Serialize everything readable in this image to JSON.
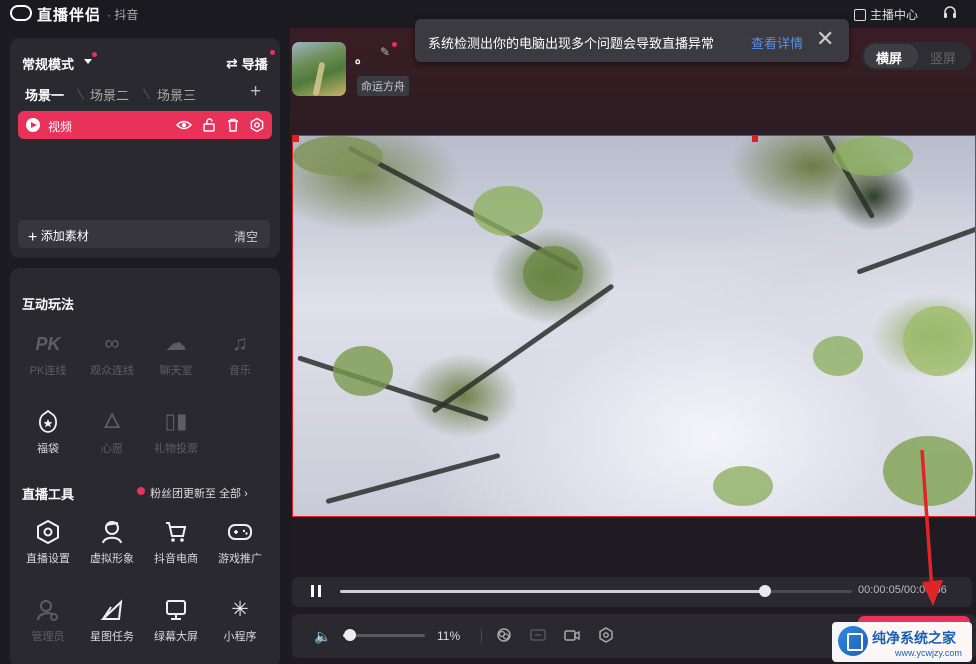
{
  "app": {
    "title": "直播伴侣",
    "platform": "· 抖音",
    "anchor_center": "主播中心"
  },
  "scene_panel": {
    "mode": "常规模式",
    "guide": "导播",
    "tabs": [
      "场景一",
      "场景二",
      "场景三"
    ],
    "source": {
      "name": "视频"
    },
    "add_material": "添加素材",
    "clear": "清空"
  },
  "interact": {
    "title": "互动玩法",
    "items": [
      {
        "label": "PK连线",
        "icon": "pk-icon"
      },
      {
        "label": "观众连线",
        "icon": "link-icon"
      },
      {
        "label": "聊天室",
        "icon": "chat-room-icon"
      },
      {
        "label": "音乐",
        "icon": "music-icon"
      },
      {
        "label": "福袋",
        "icon": "lucky-bag-icon"
      },
      {
        "label": "心愿",
        "icon": "wish-icon"
      },
      {
        "label": "礼物投票",
        "icon": "gift-vote-icon"
      }
    ]
  },
  "live_tools": {
    "title": "直播工具",
    "fans_update": "粉丝团更新至",
    "all": "全部",
    "items": [
      {
        "label": "直播设置",
        "icon": "live-settings-icon"
      },
      {
        "label": "虚拟形象",
        "icon": "avatar-icon"
      },
      {
        "label": "抖音电商",
        "icon": "cart-icon"
      },
      {
        "label": "游戏推广",
        "icon": "gamepad-icon"
      },
      {
        "label": "管理员",
        "icon": "admin-icon"
      },
      {
        "label": "星图任务",
        "icon": "star-task-icon"
      },
      {
        "label": "绿幕大屏",
        "icon": "green-screen-icon"
      },
      {
        "label": "小程序",
        "icon": "mini-program-icon"
      }
    ]
  },
  "room": {
    "title": "。",
    "name": "命运方舟"
  },
  "toast": {
    "message": "系统检测出你的电脑出现多个问题会导致直播异常",
    "link": "查看详情"
  },
  "orientation": {
    "landscape": "横屏",
    "portrait": "竖屏",
    "selected": "横屏"
  },
  "playback": {
    "time": "00:00:05/00:00:06",
    "progress": 0.83
  },
  "controls": {
    "volume": "11%"
  },
  "watermark": {
    "title": "纯净系统之家",
    "url": "www.ycwjzy.com"
  },
  "colors": {
    "accent": "#e8325a",
    "link": "#5b8ee8",
    "panel": "#2a2930"
  }
}
